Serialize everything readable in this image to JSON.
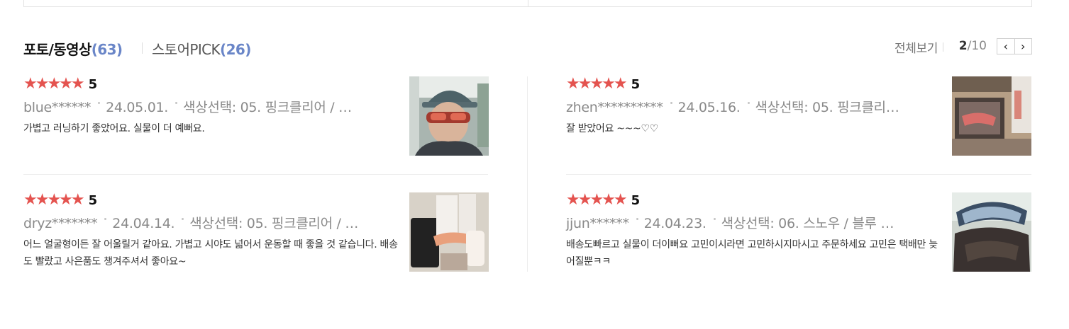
{
  "tabs": {
    "photo_label": "포토/동영상",
    "photo_count": "(63)",
    "store_label": "스토어PICK",
    "store_count": "(26)"
  },
  "header": {
    "view_all": "전체보기",
    "page_current": "2",
    "page_total": "/10",
    "prev_icon": "‹",
    "next_icon": "›"
  },
  "reviews": [
    {
      "stars": "★★★★★",
      "score": "5",
      "user": "blue******",
      "date": "24.05.01.",
      "option": "색상선택: 05. 핑크클리어 / …",
      "text": "가볍고 러닝하기 좋았어요. 실물이 더 예뻐요."
    },
    {
      "stars": "★★★★★",
      "score": "5",
      "user": "zhen**********",
      "date": "24.05.16.",
      "option": "색상선택: 05. 핑크클리…",
      "text": "잘 받았어요 ~~~♡♡"
    },
    {
      "stars": "★★★★★",
      "score": "5",
      "user": "dryz*******",
      "date": "24.04.14.",
      "option": "색상선택: 05. 핑크클리어 / …",
      "text": "어느 얼굴형이든 잘 어울릴거 같아요. 가볍고 시야도 넓어서 운동할 때 좋을 것 같습니다. 배송도 빨랐고 사은품도 챙겨주셔서 좋아요~"
    },
    {
      "stars": "★★★★★",
      "score": "5",
      "user": "jjun******",
      "date": "24.04.23.",
      "option": "색상선택: 06. 스노우 / 블루 …",
      "text": "배송도빠르고 실물이 더이뻐요 고민이시라면 고민하시지마시고 주문하세요 고민은 택배만 늦어질뿐ㅋㅋ"
    }
  ],
  "colors": {
    "star": "#e4534f",
    "count": "#6a86c8",
    "meta": "#8a8a8a"
  }
}
